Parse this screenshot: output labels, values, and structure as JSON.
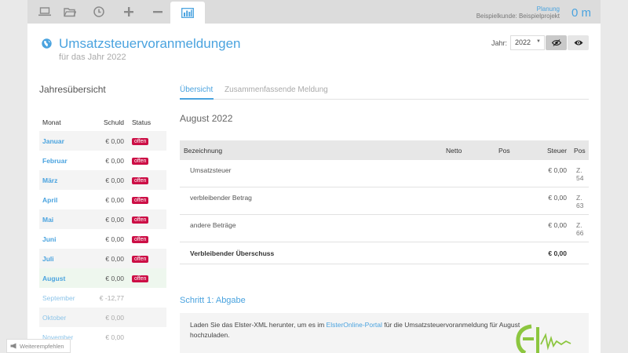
{
  "toolbar": {
    "icons": [
      "laptop-icon",
      "folder-icon",
      "clock-icon",
      "plus-icon",
      "minus-icon",
      "bar-chart-icon"
    ],
    "active": "bar-chart-icon",
    "planung_label": "Planung",
    "project_label": "Beispielkunde: Beispielprojekt",
    "om_label": "0 m"
  },
  "header": {
    "title": "Umsatzsteuervoranmeldungen",
    "subtitle": "für das Jahr 2022",
    "year_label": "Jahr:",
    "year_value": "2022"
  },
  "sidebar": {
    "title": "Jahresübersicht",
    "columns": [
      "Monat",
      "Schuld",
      "Status"
    ],
    "rows": [
      {
        "month": "Januar",
        "schuld": "€ 0,00",
        "status": "offen"
      },
      {
        "month": "Februar",
        "schuld": "€ 0,00",
        "status": "offen"
      },
      {
        "month": "März",
        "schuld": "€ 0,00",
        "status": "offen"
      },
      {
        "month": "April",
        "schuld": "€ 0,00",
        "status": "offen"
      },
      {
        "month": "Mai",
        "schuld": "€ 0,00",
        "status": "offen"
      },
      {
        "month": "Juni",
        "schuld": "€ 0,00",
        "status": "offen"
      },
      {
        "month": "Juli",
        "schuld": "€ 0,00",
        "status": "offen"
      },
      {
        "month": "August",
        "schuld": "€ 0,00",
        "status": "offen"
      },
      {
        "month": "September",
        "schuld": "€ -12,77",
        "status": ""
      },
      {
        "month": "Oktober",
        "schuld": "€ 0,00",
        "status": ""
      },
      {
        "month": "November",
        "schuld": "€ 0,00",
        "status": ""
      }
    ]
  },
  "tabs": [
    {
      "label": "Übersicht",
      "active": true
    },
    {
      "label": "Zusammenfassende Meldung",
      "active": false
    }
  ],
  "detail": {
    "month_heading": "August 2022",
    "columns": {
      "bezeichnung": "Bezeichnung",
      "netto": "Netto",
      "pos1": "Pos",
      "steuer": "Steuer",
      "pos2": "Pos"
    },
    "rows": [
      {
        "name": "Umsatzsteuer",
        "steuer": "€ 0,00",
        "pos_a": "Z.",
        "pos_b": "54"
      },
      {
        "name": "verbleibender Betrag",
        "steuer": "€ 0,00",
        "pos_a": "Z.",
        "pos_b": "63"
      },
      {
        "name": "andere Beträge",
        "steuer": "€ 0,00",
        "pos_a": "Z.",
        "pos_b": "66"
      }
    ],
    "total": {
      "name": "Verbleibender Überschuss",
      "steuer": "€ 0,00"
    }
  },
  "step1": {
    "title": "Schritt 1: Abgabe",
    "text_before": "Laden Sie das Elster-XML herunter, um es im ",
    "link": "ElsterOnline-Portal",
    "text_after": " für die Umsatzsteuervoranmeldung für August",
    "text_line2": "hochzuladen."
  },
  "footer": {
    "recommend_label": "Weiterempfehlen"
  },
  "colors": {
    "accent": "#4aa3df",
    "badge": "#cc0f46",
    "elster_green": "#8cc63f"
  }
}
